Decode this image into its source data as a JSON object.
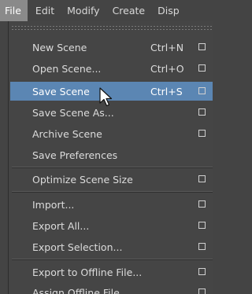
{
  "menubar": {
    "items": [
      {
        "label": "File"
      },
      {
        "label": "Edit"
      },
      {
        "label": "Modify"
      },
      {
        "label": "Create"
      },
      {
        "label": "Disp"
      }
    ]
  },
  "file_menu": {
    "items": [
      {
        "label": "New Scene",
        "shortcut": "Ctrl+N"
      },
      {
        "label": "Open Scene...",
        "shortcut": "Ctrl+O"
      },
      {
        "label": "Save Scene",
        "shortcut": "Ctrl+S"
      },
      {
        "label": "Save Scene As..."
      },
      {
        "label": "Archive Scene"
      },
      {
        "label": "Save Preferences"
      },
      {
        "label": "Optimize Scene Size"
      },
      {
        "label": "Import..."
      },
      {
        "label": "Export All..."
      },
      {
        "label": "Export Selection..."
      },
      {
        "label": "Export to Offline File..."
      },
      {
        "label": "Assign Offline File..."
      }
    ],
    "highlighted_item": "Save Scene"
  },
  "colors": {
    "menu_background": "#454545",
    "highlight": "#5b86b3",
    "active_menubar": "#8a8a8a"
  },
  "icons": [
    "option-box-icon",
    "mouse-pointer-icon"
  ]
}
